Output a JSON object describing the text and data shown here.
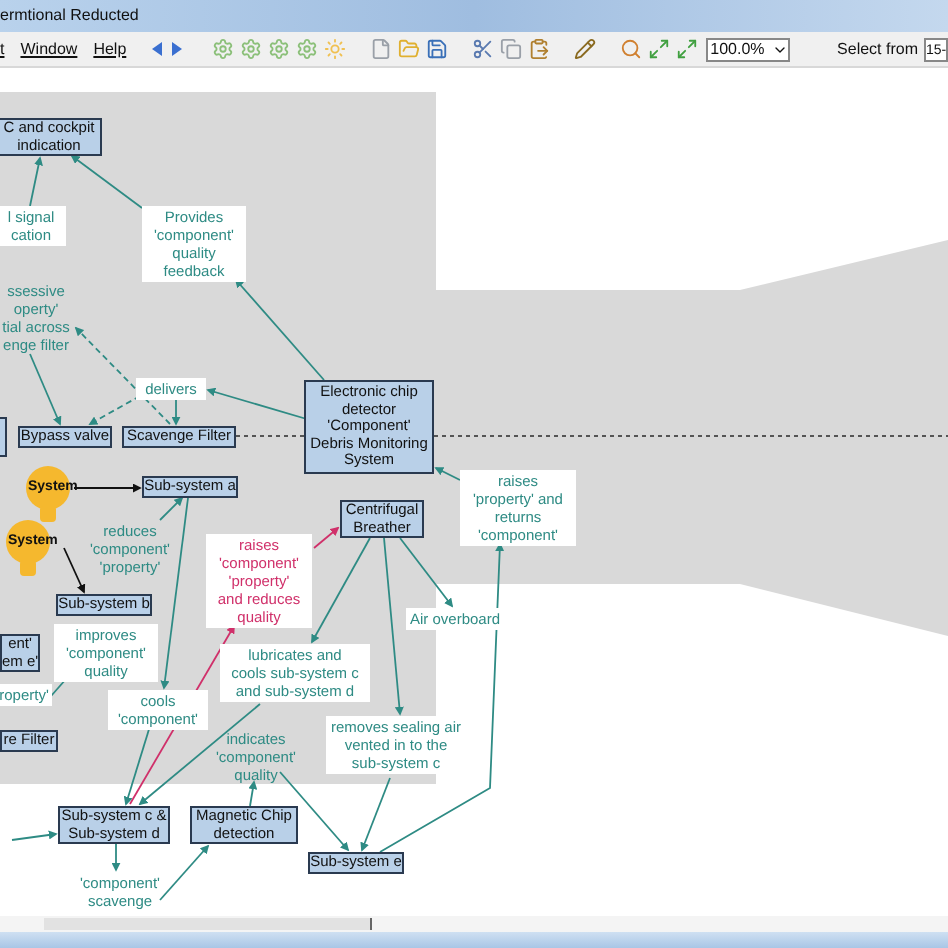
{
  "window": {
    "title": "ermtional Reducted"
  },
  "menu": [
    {
      "label": "t"
    },
    {
      "label": "Window"
    },
    {
      "label": "Help"
    }
  ],
  "toolbar": {
    "zoom": "100.0%",
    "select_label": "Select from",
    "select_value": "15-"
  },
  "diagram": {
    "nodes": [
      {
        "kind": "box",
        "text": "C and cockpit\nindication"
      },
      {
        "kind": "box",
        "text": "Bypass valve"
      },
      {
        "kind": "box",
        "text": "Scavenge Filter"
      },
      {
        "kind": "box",
        "text": "Electronic chip\ndetector\n'Component'\nDebris Monitoring\nSystem"
      },
      {
        "kind": "bulb",
        "text": "System"
      },
      {
        "kind": "box",
        "text": "Sub-system a"
      },
      {
        "kind": "bulb",
        "text": "System"
      },
      {
        "kind": "box",
        "text": "Centrifugal\nBreather"
      },
      {
        "kind": "box",
        "text": "Sub-system b"
      },
      {
        "kind": "box",
        "text": "ent'\nem e'"
      },
      {
        "kind": "box",
        "text": "re Filter"
      },
      {
        "kind": "box",
        "text": "Sub-system c &\nSub-system d"
      },
      {
        "kind": "box",
        "text": "Magnetic Chip\ndetection"
      },
      {
        "kind": "box",
        "text": "Sub-system e"
      }
    ],
    "labels": [
      {
        "kind": "boxed",
        "color": "#2e8b84",
        "text": "l signal\ncation"
      },
      {
        "kind": "boxed",
        "color": "#2e8b84",
        "text": "Provides\n'component'\nquality\nfeedback"
      },
      {
        "kind": "plain",
        "color": "#2e8b84",
        "text": "ssessive\noperty'\ntial across\nenge filter"
      },
      {
        "kind": "boxed",
        "color": "#2e8b84",
        "text": "delivers"
      },
      {
        "kind": "boxed",
        "color": "#2e8b84",
        "text": "raises\n'property' and\nreturns\n'component'"
      },
      {
        "kind": "plain",
        "color": "#2e8b84",
        "text": "reduces\n'component'\n'property'"
      },
      {
        "kind": "boxed",
        "color": "#d0306a",
        "text": "raises\n'component'\n'property'\nand reduces\nquality"
      },
      {
        "kind": "boxed",
        "color": "#2e8b84",
        "text": "Air overboard"
      },
      {
        "kind": "boxed",
        "color": "#2e8b84",
        "text": "improves\n'component'\nquality"
      },
      {
        "kind": "boxed",
        "color": "#2e8b84",
        "text": "roperty'"
      },
      {
        "kind": "boxed",
        "color": "#2e8b84",
        "text": "lubricates and\ncools sub-system c\nand sub-system d"
      },
      {
        "kind": "boxed",
        "color": "#2e8b84",
        "text": "cools\n'component'"
      },
      {
        "kind": "plain",
        "color": "#2e8b84",
        "text": "indicates\n'component'\nquality"
      },
      {
        "kind": "boxed",
        "color": "#2e8b84",
        "text": "removes sealing air\nvented in to the\nsub-system c"
      },
      {
        "kind": "plain",
        "color": "#2e8b84",
        "text": "'component'\nscavenge"
      }
    ]
  }
}
